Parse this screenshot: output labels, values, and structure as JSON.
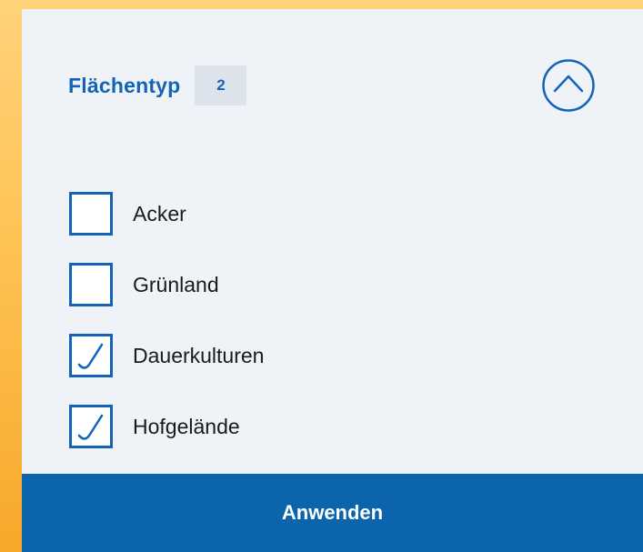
{
  "filter": {
    "title": "Flächentyp",
    "selected_count": "2",
    "toggle_icon": "chevron-up-circle-icon",
    "options": [
      {
        "label": "Acker",
        "checked": false
      },
      {
        "label": "Grünland",
        "checked": false
      },
      {
        "label": "Dauerkulturen",
        "checked": true
      },
      {
        "label": "Hofgelände",
        "checked": true
      }
    ],
    "apply_label": "Anwenden"
  },
  "colors": {
    "accent": "#1364b7",
    "panel_background": "#eff2f6",
    "badge_background": "#dde3ea",
    "button_background": "#0c64ad",
    "backdrop": "#ffc457"
  }
}
